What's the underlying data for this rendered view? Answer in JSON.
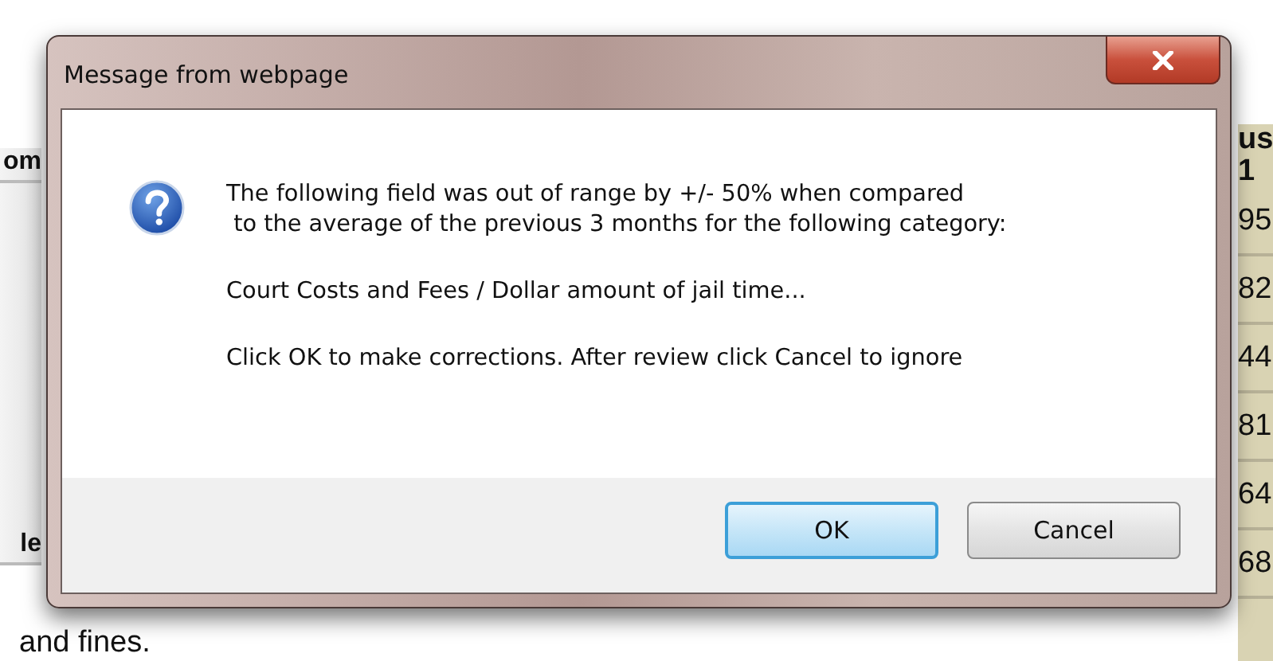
{
  "background_page": {
    "left_column": [
      "om",
      "le"
    ],
    "right_column": [
      "us",
      "1",
      "95",
      "82",
      "44",
      "81",
      "64",
      "68"
    ],
    "footnote": "and fines."
  },
  "dialog": {
    "title": "Message from webpage",
    "message": [
      "The following field was out of range by +/- 50% when compared",
      " to the average of the previous 3 months for the following category:",
      "Court Costs and Fees / Dollar amount of jail time...",
      "Click OK to make corrections. After review click Cancel to ignore"
    ],
    "buttons": [
      {
        "label": "OK",
        "selected": true
      },
      {
        "label": "Cancel",
        "selected": false
      }
    ]
  }
}
